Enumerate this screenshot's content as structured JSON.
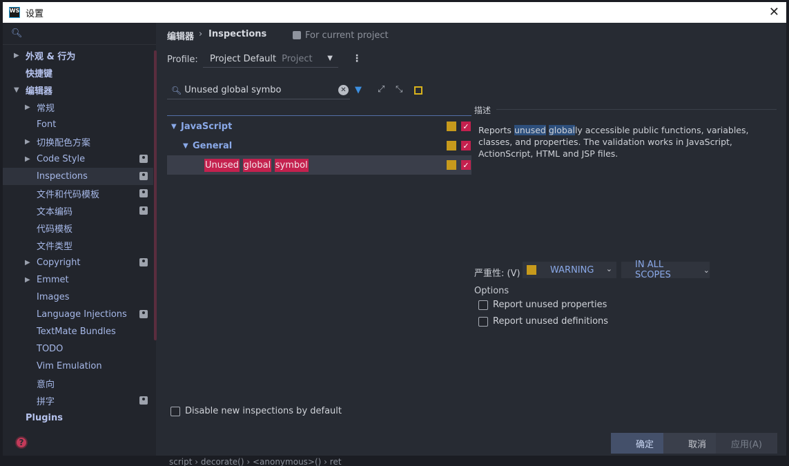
{
  "window": {
    "title": "设置",
    "app_icon": "WS"
  },
  "sidebar": {
    "search_placeholder": "",
    "items": [
      {
        "label": "外观 & 行为",
        "arrow": "▶",
        "bold": true,
        "indent": 0
      },
      {
        "label": "快捷键",
        "arrow": "",
        "bold": true,
        "indent": 0
      },
      {
        "label": "编辑器",
        "arrow": "▼",
        "bold": true,
        "indent": 0
      },
      {
        "label": "常规",
        "arrow": "▶",
        "bold": false,
        "indent": 1
      },
      {
        "label": "Font",
        "arrow": "",
        "bold": false,
        "indent": 1
      },
      {
        "label": "切换配色方案",
        "arrow": "▶",
        "bold": false,
        "indent": 1
      },
      {
        "label": "Code Style",
        "arrow": "▶",
        "bold": false,
        "indent": 1,
        "project": true
      },
      {
        "label": "Inspections",
        "arrow": "",
        "bold": false,
        "indent": 1,
        "project": true,
        "selected": true
      },
      {
        "label": "文件和代码模板",
        "arrow": "",
        "bold": false,
        "indent": 1,
        "project": true
      },
      {
        "label": "文本编码",
        "arrow": "",
        "bold": false,
        "indent": 1,
        "project": true
      },
      {
        "label": "代码模板",
        "arrow": "",
        "bold": false,
        "indent": 1
      },
      {
        "label": "文件类型",
        "arrow": "",
        "bold": false,
        "indent": 1
      },
      {
        "label": "Copyright",
        "arrow": "▶",
        "bold": false,
        "indent": 1,
        "project": true
      },
      {
        "label": "Emmet",
        "arrow": "▶",
        "bold": false,
        "indent": 1
      },
      {
        "label": "Images",
        "arrow": "",
        "bold": false,
        "indent": 1
      },
      {
        "label": "Language Injections",
        "arrow": "",
        "bold": false,
        "indent": 1,
        "project": true
      },
      {
        "label": "TextMate Bundles",
        "arrow": "",
        "bold": false,
        "indent": 1
      },
      {
        "label": "TODO",
        "arrow": "",
        "bold": false,
        "indent": 1
      },
      {
        "label": "Vim Emulation",
        "arrow": "",
        "bold": false,
        "indent": 1
      },
      {
        "label": "意向",
        "arrow": "",
        "bold": false,
        "indent": 1
      },
      {
        "label": "拼字",
        "arrow": "",
        "bold": false,
        "indent": 1,
        "project": true
      },
      {
        "label": "Plugins",
        "arrow": "",
        "bold": true,
        "indent": 0
      }
    ]
  },
  "header": {
    "breadcrumb_parent": "编辑器",
    "breadcrumb_separator": "›",
    "breadcrumb_current": "Inspections",
    "scope_label": "For current project"
  },
  "profile": {
    "label": "Profile:",
    "value": "Project Default",
    "scope": "Project",
    "more": "⋮"
  },
  "filter": {
    "search_value": "Unused global symbo"
  },
  "tree": {
    "rows": [
      {
        "label": "JavaScript",
        "level": 0
      },
      {
        "label": "General",
        "level": 1
      },
      {
        "label_parts": [
          "Unused",
          "global",
          "symbol"
        ],
        "level": 2
      }
    ]
  },
  "description": {
    "title": "描述",
    "parts": [
      "Reports ",
      "unused",
      " ",
      "global",
      "ly accessible public functions, variables, classes, and properties. The validation works in JavaScript, ActionScript, HTML and JSP files."
    ]
  },
  "severity": {
    "label": "严重性: (V)",
    "value": "WARNING",
    "scope": "IN ALL SCOPES",
    "color": "#c79a1c"
  },
  "options": {
    "title": "Options",
    "items": [
      "Report unused properties",
      "Report unused definitions"
    ]
  },
  "disable_new": "Disable new inspections by default",
  "buttons": {
    "ok": "确定",
    "cancel": "取消",
    "apply": "应用(A)"
  },
  "statusbar": {
    "crumbs": "script  ›  decorate()  ›  <anonymous>()  ›  ret"
  },
  "colors": {
    "accent": "#8aa9e8",
    "error": "#c4214e",
    "warning": "#c79a1c"
  }
}
